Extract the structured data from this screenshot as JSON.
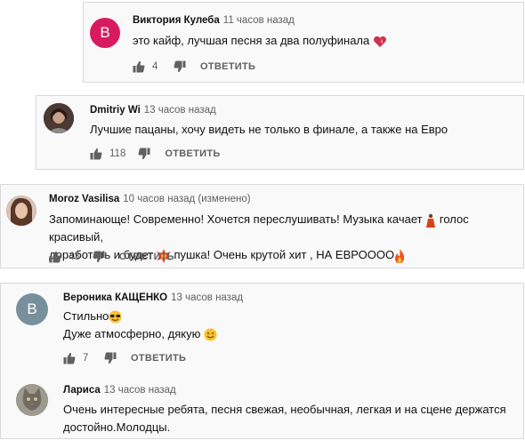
{
  "colors": {
    "avatar_v_pink": "#d81b60",
    "avatar_v_gray": "#78909c",
    "meta_gray": "#606060"
  },
  "labels": {
    "reply": "ОТВЕТИТЬ"
  },
  "comments": [
    {
      "author": "Виктория Кулеба",
      "time": "11 часов назад",
      "avatar_letter": "В",
      "text": "это кайф, лучшая песня за два полуфинала",
      "emoji_end": "heart-icon",
      "likes": "4"
    },
    {
      "author": "Dmitriy Wi",
      "time": "13 часов назад",
      "avatar_icon": "user-photo",
      "text": "Лучшие пацаны, хочу видеть не только в финале, а также на Евро",
      "likes": "118"
    },
    {
      "author": "Moroz Vasilisa",
      "time": "10 часов назад (изменено)",
      "avatar_icon": "user-photo",
      "text_part1": "Запоминающе! Современно! Хочется переслушивать! Музыка качает",
      "text_part2": "голос красивый,",
      "text_line2a": "доработать и будет",
      "text_line2b": "пушка! Очень крутой хит , НА ЕВРОООО",
      "likes": "43"
    },
    {
      "author": "Вероника КАЩЕНКО",
      "time": "13 часов назад",
      "avatar_letter": "В",
      "text_line1": "Стильно",
      "text_line2": "Дуже атмосферно, дякую",
      "likes": "7"
    },
    {
      "author": "Лариса",
      "time": "13 часов назад",
      "avatar_icon": "cat-photo",
      "text_line1": "Очень интересные ребята, песня свежая, необычная, легкая и на сцене держатся",
      "text_line2": "достойно.Молодцы."
    }
  ]
}
